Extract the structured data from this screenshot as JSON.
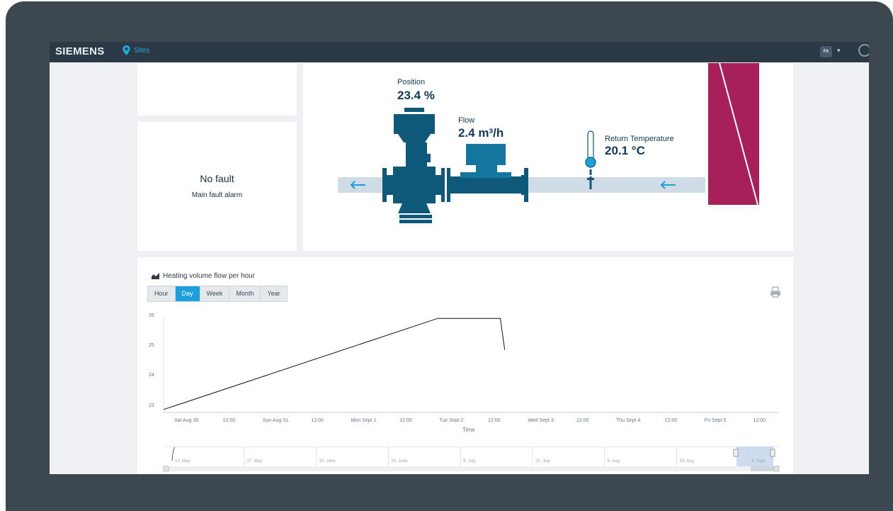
{
  "header": {
    "brand": "SIEMENS",
    "nav_label": "Sites",
    "user_initials": "FA",
    "caret": "▾"
  },
  "fault": {
    "status": "No fault",
    "label": "Main fault alarm"
  },
  "valve": {
    "position_label": "Position",
    "position_value": "23.4 %",
    "flow_label": "Flow",
    "flow_value": "2.4 m³/h",
    "return_temp_label": "Return Temperature",
    "return_temp_value": "20.1 °C"
  },
  "chart_panel": {
    "title": "Heating volume flow per hour",
    "tabs": [
      {
        "label": "Hour",
        "active": false
      },
      {
        "label": "Day",
        "active": true
      },
      {
        "label": "Week",
        "active": false
      },
      {
        "label": "Month",
        "active": false
      },
      {
        "label": "Year",
        "active": false
      }
    ],
    "navigator_labels": [
      "13. May",
      "27. May",
      "10. June",
      "24. June",
      "8. July",
      "22. July",
      "5. Aug",
      "19. Aug",
      "2. Sept"
    ]
  },
  "colors": {
    "accent": "#1d9fde",
    "pipe_dark": "#0e587a",
    "pipe_light": "#cfdce6",
    "magenta": "#a8205a"
  },
  "chart_data": {
    "type": "line",
    "title": "Heating volume flow per hour",
    "xlabel": "Time",
    "ylabel": "",
    "x_tick_labels": [
      "Sat Aug 30.",
      "12:00",
      "Sun Aug 31.",
      "12:00",
      "Mon Sept 1.",
      "12:00",
      "Tue Sept 2.",
      "12:00",
      "Wed Sept 3.",
      "12:00",
      "Thu Sept 4.",
      "12:00",
      "Fri Sept 5.",
      "12:00"
    ],
    "y_tick_labels": [
      "26",
      "25",
      "24",
      "23"
    ],
    "ylim": [
      22.8,
      26.05
    ],
    "xlim": [
      0,
      7.0
    ],
    "series": [
      {
        "x": [
          0,
          3.12,
          3.83,
          3.88
        ],
        "y": [
          22.9,
          25.95,
          25.95,
          24.9
        ]
      }
    ]
  }
}
